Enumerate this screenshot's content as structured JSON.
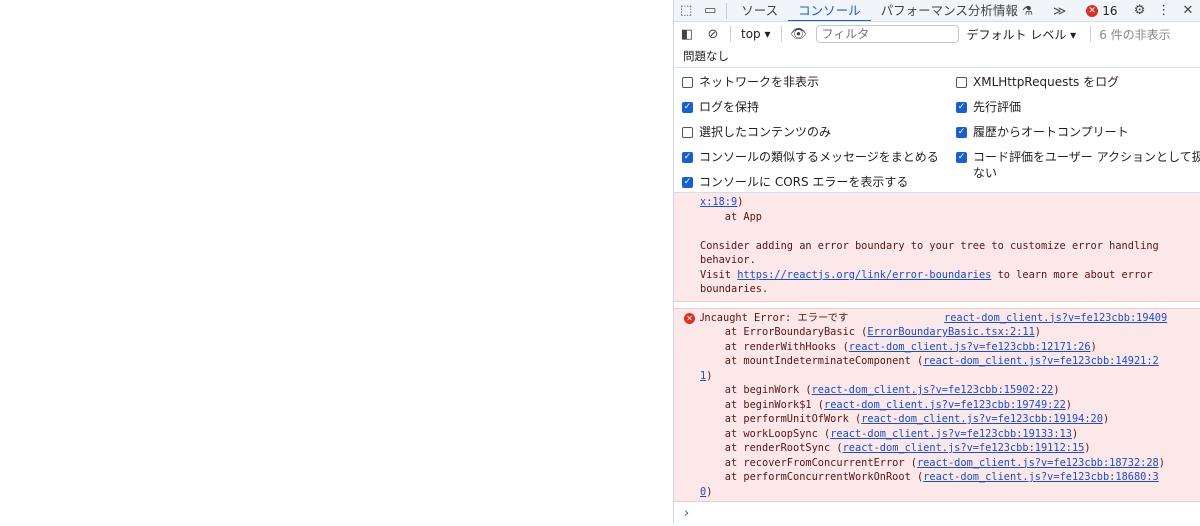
{
  "toolbar": {
    "tabs": [
      "ソース",
      "コンソール",
      "パフォーマンス分析情報 ⚗",
      "≫"
    ],
    "error_count": "16"
  },
  "console_toolbar": {
    "context": "top",
    "filter_placeholder": "フィルタ",
    "level": "デフォルト レベル",
    "hidden": "6 件の非表示"
  },
  "issues": "問題なし",
  "settings": {
    "left": [
      {
        "label": "ネットワークを非表示",
        "checked": false
      },
      {
        "label": "ログを保持",
        "checked": true
      },
      {
        "label": "選択したコンテンツのみ",
        "checked": false
      },
      {
        "label": "コンソールの類似するメッセージをまとめる",
        "checked": true
      },
      {
        "label": "コンソールに CORS エラーを表示する",
        "checked": true
      }
    ],
    "right": [
      {
        "label": "XMLHttpRequests をログ",
        "checked": false
      },
      {
        "label": "先行評価",
        "checked": true
      },
      {
        "label": "履歴からオートコンプリート",
        "checked": true
      },
      {
        "label": "コード評価をユーザー アクションとして扱わ\nない",
        "checked": true
      }
    ]
  },
  "msg1": {
    "link_tail": "x:18:9",
    "l1": "    at App",
    "l3": "Consider adding an error boundary to your tree to customize error handling",
    "l4": "behavior.",
    "visit": "Visit ",
    "url": "https://reactjs.org/link/error-boundaries",
    "after": " to learn more about error",
    "l6": "boundaries."
  },
  "msg2": {
    "title": "Uncaught Error: エラーです",
    "source": "react-dom_client.js?v=fe123cbb:19409",
    "frames": [
      [
        "    at ErrorBoundaryBasic (",
        "ErrorBoundaryBasic.tsx:2:11",
        ")"
      ],
      [
        "    at renderWithHooks (",
        "react-dom_client.js?v=fe123cbb:12171:26",
        ")"
      ],
      [
        "    at mountIndeterminateComponent (",
        "react-dom_client.js?v=fe123cbb:14921:2",
        ""
      ],
      [
        "",
        "1",
        ")"
      ],
      [
        "    at beginWork (",
        "react-dom_client.js?v=fe123cbb:15902:22",
        ")"
      ],
      [
        "    at beginWork$1 (",
        "react-dom_client.js?v=fe123cbb:19749:22",
        ")"
      ],
      [
        "    at performUnitOfWork (",
        "react-dom_client.js?v=fe123cbb:19194:20",
        ")"
      ],
      [
        "    at workLoopSync (",
        "react-dom_client.js?v=fe123cbb:19133:13",
        ")"
      ],
      [
        "    at renderRootSync (",
        "react-dom_client.js?v=fe123cbb:19112:15",
        ")"
      ],
      [
        "    at recoverFromConcurrentError (",
        "react-dom_client.js?v=fe123cbb:18732:28",
        ")"
      ],
      [
        "    at performConcurrentWorkOnRoot (",
        "react-dom_client.js?v=fe123cbb:18680:3",
        ""
      ],
      [
        "",
        "0",
        ")"
      ]
    ]
  }
}
